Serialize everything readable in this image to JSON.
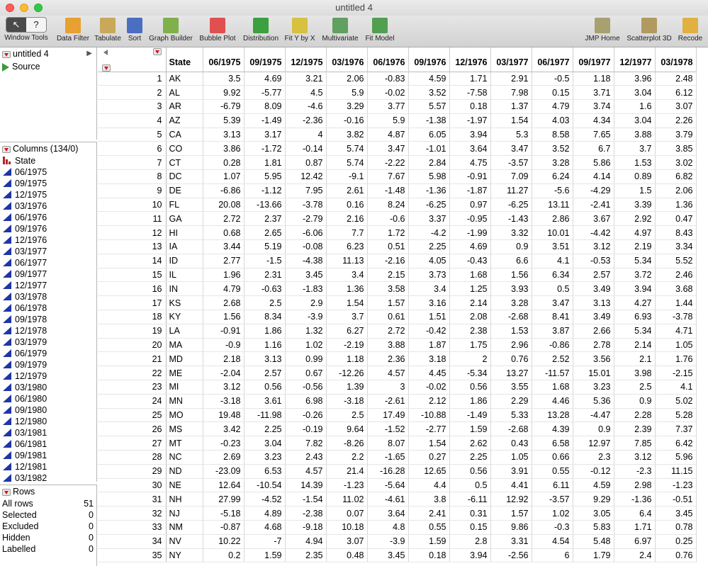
{
  "window": {
    "title": "untitled 4"
  },
  "toolbar": {
    "seg_arrow": "↖",
    "seg_help": "?",
    "items": [
      {
        "label": "Window Tools",
        "color": "#4a4a4a"
      },
      {
        "label": "Data Filter",
        "color": "#e8a030"
      },
      {
        "label": "Tabulate",
        "color": "#c9a85a"
      },
      {
        "label": "Sort",
        "color": "#4a6fc0"
      },
      {
        "label": "Graph Builder",
        "color": "#7fb04a"
      },
      {
        "label": "Bubble Plot",
        "color": "#e05050"
      },
      {
        "label": "Distribution",
        "color": "#3aa040"
      },
      {
        "label": "Fit Y by X",
        "color": "#d8c040"
      },
      {
        "label": "Multivariate",
        "color": "#60a060"
      },
      {
        "label": "Fit Model",
        "color": "#50a050"
      },
      {
        "label": "JMP Home",
        "color": "#a8a070"
      },
      {
        "label": "Scatterplot 3D",
        "color": "#b09a60"
      },
      {
        "label": "Recode",
        "color": "#e0b040"
      }
    ]
  },
  "table_panel": {
    "name": "untitled 4",
    "source": "Source"
  },
  "columns_panel": {
    "header": "Columns (134/0)",
    "items": [
      "State",
      "06/1975",
      "09/1975",
      "12/1975",
      "03/1976",
      "06/1976",
      "09/1976",
      "12/1976",
      "03/1977",
      "06/1977",
      "09/1977",
      "12/1977",
      "03/1978",
      "06/1978",
      "09/1978",
      "12/1978",
      "03/1979",
      "06/1979",
      "09/1979",
      "12/1979",
      "03/1980",
      "06/1980",
      "09/1980",
      "12/1980",
      "03/1981",
      "06/1981",
      "09/1981",
      "12/1981",
      "03/1982"
    ]
  },
  "rows_panel": {
    "header": "Rows",
    "stats": [
      {
        "label": "All rows",
        "value": "51"
      },
      {
        "label": "Selected",
        "value": "0"
      },
      {
        "label": "Excluded",
        "value": "0"
      },
      {
        "label": "Hidden",
        "value": "0"
      },
      {
        "label": "Labelled",
        "value": "0"
      }
    ]
  },
  "grid": {
    "headers": [
      "State",
      "06/1975",
      "09/1975",
      "12/1975",
      "03/1976",
      "06/1976",
      "09/1976",
      "12/1976",
      "03/1977",
      "06/1977",
      "09/1977",
      "12/1977",
      "03/1978"
    ],
    "rows": [
      [
        "1",
        "AK",
        "3.5",
        "4.69",
        "3.21",
        "2.06",
        "-0.83",
        "4.59",
        "1.71",
        "2.91",
        "-0.5",
        "1.18",
        "3.96",
        "2.48"
      ],
      [
        "2",
        "AL",
        "9.92",
        "-5.77",
        "4.5",
        "5.9",
        "-0.02",
        "3.52",
        "-7.58",
        "7.98",
        "0.15",
        "3.71",
        "3.04",
        "6.12"
      ],
      [
        "3",
        "AR",
        "-6.79",
        "8.09",
        "-4.6",
        "3.29",
        "3.77",
        "5.57",
        "0.18",
        "1.37",
        "4.79",
        "3.74",
        "1.6",
        "3.07"
      ],
      [
        "4",
        "AZ",
        "5.39",
        "-1.49",
        "-2.36",
        "-0.16",
        "5.9",
        "-1.38",
        "-1.97",
        "1.54",
        "4.03",
        "4.34",
        "3.04",
        "2.26"
      ],
      [
        "5",
        "CA",
        "3.13",
        "3.17",
        "4",
        "3.82",
        "4.87",
        "6.05",
        "3.94",
        "5.3",
        "8.58",
        "7.65",
        "3.88",
        "3.79"
      ],
      [
        "6",
        "CO",
        "3.86",
        "-1.72",
        "-0.14",
        "5.74",
        "3.47",
        "-1.01",
        "3.64",
        "3.47",
        "3.52",
        "6.7",
        "3.7",
        "3.85"
      ],
      [
        "7",
        "CT",
        "0.28",
        "1.81",
        "0.87",
        "5.74",
        "-2.22",
        "2.84",
        "4.75",
        "-3.57",
        "3.28",
        "5.86",
        "1.53",
        "3.02"
      ],
      [
        "8",
        "DC",
        "1.07",
        "5.95",
        "12.42",
        "-9.1",
        "7.67",
        "5.98",
        "-0.91",
        "7.09",
        "6.24",
        "4.14",
        "0.89",
        "6.82"
      ],
      [
        "9",
        "DE",
        "-6.86",
        "-1.12",
        "7.95",
        "2.61",
        "-1.48",
        "-1.36",
        "-1.87",
        "11.27",
        "-5.6",
        "-4.29",
        "1.5",
        "2.06"
      ],
      [
        "10",
        "FL",
        "20.08",
        "-13.66",
        "-3.78",
        "0.16",
        "8.24",
        "-6.25",
        "0.97",
        "-6.25",
        "13.11",
        "-2.41",
        "3.39",
        "1.36"
      ],
      [
        "11",
        "GA",
        "2.72",
        "2.37",
        "-2.79",
        "2.16",
        "-0.6",
        "3.37",
        "-0.95",
        "-1.43",
        "2.86",
        "3.67",
        "2.92",
        "0.47"
      ],
      [
        "12",
        "HI",
        "0.68",
        "2.65",
        "-6.06",
        "7.7",
        "1.72",
        "-4.2",
        "-1.99",
        "3.32",
        "10.01",
        "-4.42",
        "4.97",
        "8.43"
      ],
      [
        "13",
        "IA",
        "3.44",
        "5.19",
        "-0.08",
        "6.23",
        "0.51",
        "2.25",
        "4.69",
        "0.9",
        "3.51",
        "3.12",
        "2.19",
        "3.34"
      ],
      [
        "14",
        "ID",
        "2.77",
        "-1.5",
        "-4.38",
        "11.13",
        "-2.16",
        "4.05",
        "-0.43",
        "6.6",
        "4.1",
        "-0.53",
        "5.34",
        "5.52"
      ],
      [
        "15",
        "IL",
        "1.96",
        "2.31",
        "3.45",
        "3.4",
        "2.15",
        "3.73",
        "1.68",
        "1.56",
        "6.34",
        "2.57",
        "3.72",
        "2.46"
      ],
      [
        "16",
        "IN",
        "4.79",
        "-0.63",
        "-1.83",
        "1.36",
        "3.58",
        "3.4",
        "1.25",
        "3.93",
        "0.5",
        "3.49",
        "3.94",
        "3.68"
      ],
      [
        "17",
        "KS",
        "2.68",
        "2.5",
        "2.9",
        "1.54",
        "1.57",
        "3.16",
        "2.14",
        "3.28",
        "3.47",
        "3.13",
        "4.27",
        "1.44"
      ],
      [
        "18",
        "KY",
        "1.56",
        "8.34",
        "-3.9",
        "3.7",
        "0.61",
        "1.51",
        "2.08",
        "-2.68",
        "8.41",
        "3.49",
        "6.93",
        "-3.78"
      ],
      [
        "19",
        "LA",
        "-0.91",
        "1.86",
        "1.32",
        "6.27",
        "2.72",
        "-0.42",
        "2.38",
        "1.53",
        "3.87",
        "2.66",
        "5.34",
        "4.71"
      ],
      [
        "20",
        "MA",
        "-0.9",
        "1.16",
        "1.02",
        "-2.19",
        "3.88",
        "1.87",
        "1.75",
        "2.96",
        "-0.86",
        "2.78",
        "2.14",
        "1.05"
      ],
      [
        "21",
        "MD",
        "2.18",
        "3.13",
        "0.99",
        "1.18",
        "2.36",
        "3.18",
        "2",
        "0.76",
        "2.52",
        "3.56",
        "2.1",
        "1.76"
      ],
      [
        "22",
        "ME",
        "-2.04",
        "2.57",
        "0.67",
        "-12.26",
        "4.57",
        "4.45",
        "-5.34",
        "13.27",
        "-11.57",
        "15.01",
        "3.98",
        "-2.15"
      ],
      [
        "23",
        "MI",
        "3.12",
        "0.56",
        "-0.56",
        "1.39",
        "3",
        "-0.02",
        "0.56",
        "3.55",
        "1.68",
        "3.23",
        "2.5",
        "4.1"
      ],
      [
        "24",
        "MN",
        "-3.18",
        "3.61",
        "6.98",
        "-3.18",
        "-2.61",
        "2.12",
        "1.86",
        "2.29",
        "4.46",
        "5.36",
        "0.9",
        "5.02"
      ],
      [
        "25",
        "MO",
        "19.48",
        "-11.98",
        "-0.26",
        "2.5",
        "17.49",
        "-10.88",
        "-1.49",
        "5.33",
        "13.28",
        "-4.47",
        "2.28",
        "5.28"
      ],
      [
        "26",
        "MS",
        "3.42",
        "2.25",
        "-0.19",
        "9.64",
        "-1.52",
        "-2.77",
        "1.59",
        "-2.68",
        "4.39",
        "0.9",
        "2.39",
        "7.37"
      ],
      [
        "27",
        "MT",
        "-0.23",
        "3.04",
        "7.82",
        "-8.26",
        "8.07",
        "1.54",
        "2.62",
        "0.43",
        "6.58",
        "12.97",
        "7.85",
        "6.42"
      ],
      [
        "28",
        "NC",
        "2.69",
        "3.23",
        "2.43",
        "2.2",
        "-1.65",
        "0.27",
        "2.25",
        "1.05",
        "0.66",
        "2.3",
        "3.12",
        "5.96"
      ],
      [
        "29",
        "ND",
        "-23.09",
        "6.53",
        "4.57",
        "21.4",
        "-16.28",
        "12.65",
        "0.56",
        "3.91",
        "0.55",
        "-0.12",
        "-2.3",
        "11.15"
      ],
      [
        "30",
        "NE",
        "12.64",
        "-10.54",
        "14.39",
        "-1.23",
        "-5.64",
        "4.4",
        "0.5",
        "4.41",
        "6.11",
        "4.59",
        "2.98",
        "-1.23"
      ],
      [
        "31",
        "NH",
        "27.99",
        "-4.52",
        "-1.54",
        "11.02",
        "-4.61",
        "3.8",
        "-6.11",
        "12.92",
        "-3.57",
        "9.29",
        "-1.36",
        "-0.51"
      ],
      [
        "32",
        "NJ",
        "-5.18",
        "4.89",
        "-2.38",
        "0.07",
        "3.64",
        "2.41",
        "0.31",
        "1.57",
        "1.02",
        "3.05",
        "6.4",
        "3.45"
      ],
      [
        "33",
        "NM",
        "-0.87",
        "4.68",
        "-9.18",
        "10.18",
        "4.8",
        "0.55",
        "0.15",
        "9.86",
        "-0.3",
        "5.83",
        "1.71",
        "0.78"
      ],
      [
        "34",
        "NV",
        "10.22",
        "-7",
        "4.94",
        "3.07",
        "-3.9",
        "1.59",
        "2.8",
        "3.31",
        "4.54",
        "5.48",
        "6.97",
        "0.25"
      ],
      [
        "35",
        "NY",
        "0.2",
        "1.59",
        "2.35",
        "0.48",
        "3.45",
        "0.18",
        "3.94",
        "-2.56",
        "6",
        "1.79",
        "2.4",
        "0.76"
      ]
    ]
  }
}
